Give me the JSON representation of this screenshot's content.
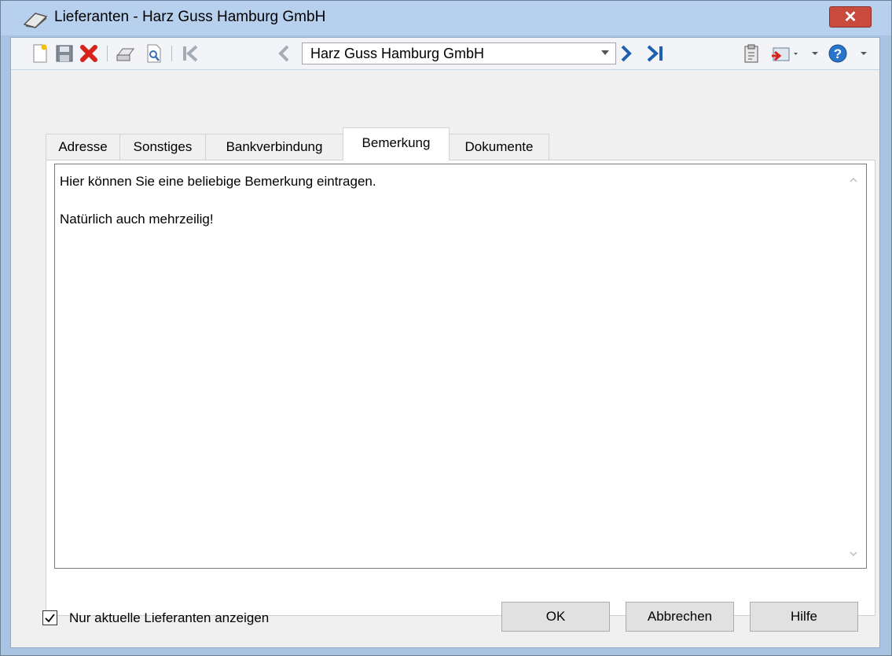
{
  "window": {
    "title": "Lieferanten - Harz Guss Hamburg GmbH",
    "close_symbol": "✕"
  },
  "toolbar": {
    "record_selector": {
      "value": "Harz Guss Hamburg GmbH"
    },
    "icons": [
      "new-document-icon",
      "save-icon",
      "delete-icon",
      "print-icon",
      "print-preview-icon",
      "first-record-icon",
      "previous-record-icon",
      "next-record-icon",
      "last-record-icon",
      "clipboard-icon",
      "export-icon",
      "help-icon"
    ]
  },
  "tabs": [
    {
      "label": "Adresse",
      "active": false
    },
    {
      "label": "Sonstiges",
      "active": false
    },
    {
      "label": "Bankverbindung",
      "active": false
    },
    {
      "label": "Bemerkung",
      "active": true
    },
    {
      "label": "Dokumente",
      "active": false
    }
  ],
  "remark": {
    "lines": [
      "Hier können Sie eine beliebige Bemerkung eintragen.",
      "",
      "Natürlich auch mehrzeilig!"
    ]
  },
  "footer": {
    "only_current_checkbox": {
      "label": "Nur aktuelle Lieferanten anzeigen",
      "checked": true
    },
    "ok_label": "OK",
    "cancel_label": "Abbrechen",
    "help_label": "Hilfe"
  },
  "colors": {
    "title_bar": "#b7d0ee",
    "close_button": "#c94b3e",
    "delete_red": "#d6231c",
    "nav_blue": "#1d5fb0"
  }
}
